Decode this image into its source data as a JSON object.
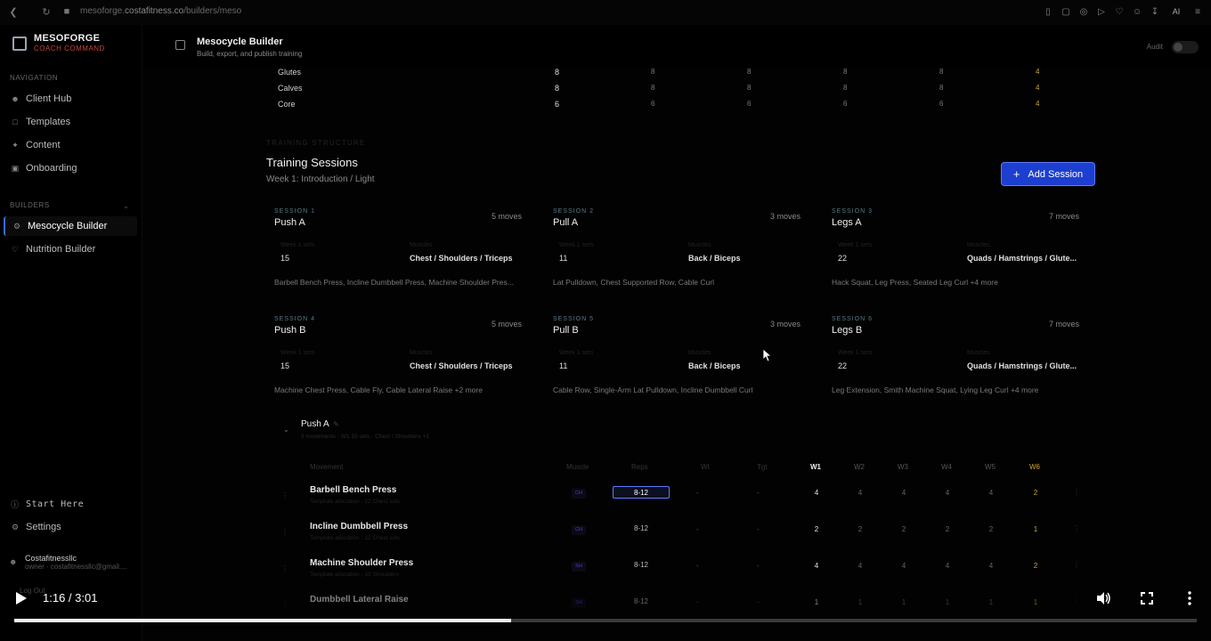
{
  "browser": {
    "url_domain": "mesoforge.",
    "url_mid": "costafitness.co",
    "url_path": "/builders/meso",
    "ai_label": "AI"
  },
  "sidebar": {
    "brand_name": "MESOFORGE",
    "brand_sub": "COACH COMMAND",
    "nav_label": "NAVIGATION",
    "nav_items": [
      {
        "label": "Client Hub",
        "icon": "users-icon"
      },
      {
        "label": "Templates",
        "icon": "file-icon"
      },
      {
        "label": "Content",
        "icon": "sparkle-icon"
      },
      {
        "label": "Onboarding",
        "icon": "clipboard-icon"
      }
    ],
    "builders_label": "BUILDERS",
    "builder_items": [
      {
        "label": "Mesocycle Builder",
        "icon": "sliders-icon",
        "active": true
      },
      {
        "label": "Nutrition Builder",
        "icon": "heart-icon",
        "active": false
      }
    ],
    "start_here": "Start Here",
    "settings": "Settings",
    "user_name": "Costafitnessllc",
    "user_email": "owner · costafitnessllc@gmail....",
    "logout": "Log Out"
  },
  "header": {
    "title": "Mesocycle Builder",
    "subtitle": "Build, export, and publish training",
    "audit_label": "Audit"
  },
  "volume_rows": [
    {
      "muscle": "Glutes",
      "values": [
        "8",
        "8",
        "8",
        "8",
        "8",
        "4"
      ]
    },
    {
      "muscle": "Calves",
      "values": [
        "8",
        "8",
        "8",
        "8",
        "8",
        "4"
      ]
    },
    {
      "muscle": "Core",
      "values": [
        "6",
        "6",
        "6",
        "6",
        "6",
        "4"
      ]
    }
  ],
  "training": {
    "eyebrow": "TRAINING STRUCTURE",
    "title": "Training Sessions",
    "subtitle": "Week 1: Introduction / Light",
    "add_session": "Add Session",
    "week_sets_label": "Week 1 sets",
    "muscles_label": "Muscles"
  },
  "sessions": [
    {
      "session": "SESSION 1",
      "name": "Push A",
      "moves": "5 moves",
      "sets": "15",
      "muscles": "Chest / Shoulders / Triceps",
      "exercises": "Barbell Bench Press, Incline Dumbbell Press, Machine Shoulder Pres..."
    },
    {
      "session": "SESSION 2",
      "name": "Pull A",
      "moves": "3 moves",
      "sets": "11",
      "muscles": "Back / Biceps",
      "exercises": "Lat Pulldown, Chest Supported Row, Cable Curl"
    },
    {
      "session": "SESSION 3",
      "name": "Legs A",
      "moves": "7 moves",
      "sets": "22",
      "muscles": "Quads / Hamstrings / Glute...",
      "exercises": "Hack Squat, Leg Press, Seated Leg Curl +4 more"
    },
    {
      "session": "SESSION 4",
      "name": "Push B",
      "moves": "5 moves",
      "sets": "15",
      "muscles": "Chest / Shoulders / Triceps",
      "exercises": "Machine Chest Press, Cable Fly, Cable Lateral Raise +2 more"
    },
    {
      "session": "SESSION 5",
      "name": "Pull B",
      "moves": "3 moves",
      "sets": "11",
      "muscles": "Back / Biceps",
      "exercises": "Cable Row, Single-Arm Lat Pulldown, Incline Dumbbell Curl"
    },
    {
      "session": "SESSION 6",
      "name": "Legs B",
      "moves": "7 moves",
      "sets": "22",
      "muscles": "Quads / Hamstrings / Glute...",
      "exercises": "Leg Extension, Smith Machine Squat, Lying Leg Curl +4 more"
    }
  ],
  "day": {
    "name": "Push A",
    "meta": "5 movements · W1 15 sets · Chest / Shoulders +1",
    "columns": {
      "movement": "Movement",
      "muscle": "Muscle",
      "reps": "Reps",
      "wt": "Wt",
      "tgt": "Tgt"
    },
    "weeks": [
      "W1",
      "W2",
      "W3",
      "W4",
      "W5",
      "W6"
    ]
  },
  "exercises": [
    {
      "name": "Barbell Bench Press",
      "caption": "Template allocation · 12 Chest sets",
      "muscle": "CH",
      "reps": "8-12",
      "wt": "-",
      "tgt": "-",
      "weeks": [
        "4",
        "4",
        "4",
        "4",
        "4",
        "2"
      ]
    },
    {
      "name": "Incline Dumbbell Press",
      "caption": "Template allocation · 12 Chest sets",
      "muscle": "CH",
      "reps": "8-12",
      "wt": "-",
      "tgt": "-",
      "weeks": [
        "2",
        "2",
        "2",
        "2",
        "2",
        "1"
      ]
    },
    {
      "name": "Machine Shoulder Press",
      "caption": "Template allocation · 10 Shoulders",
      "muscle": "SH",
      "reps": "8-12",
      "wt": "-",
      "tgt": "-",
      "weeks": [
        "4",
        "4",
        "4",
        "4",
        "4",
        "2"
      ]
    },
    {
      "name": "Dumbbell Lateral Raise",
      "caption": "",
      "muscle": "SH",
      "reps": "8-12",
      "wt": "-",
      "tgt": "-",
      "weeks": [
        "1",
        "1",
        "1",
        "1",
        "1",
        "1"
      ]
    }
  ],
  "video": {
    "time": "1:16 / 3:01",
    "progress": 0.42
  }
}
